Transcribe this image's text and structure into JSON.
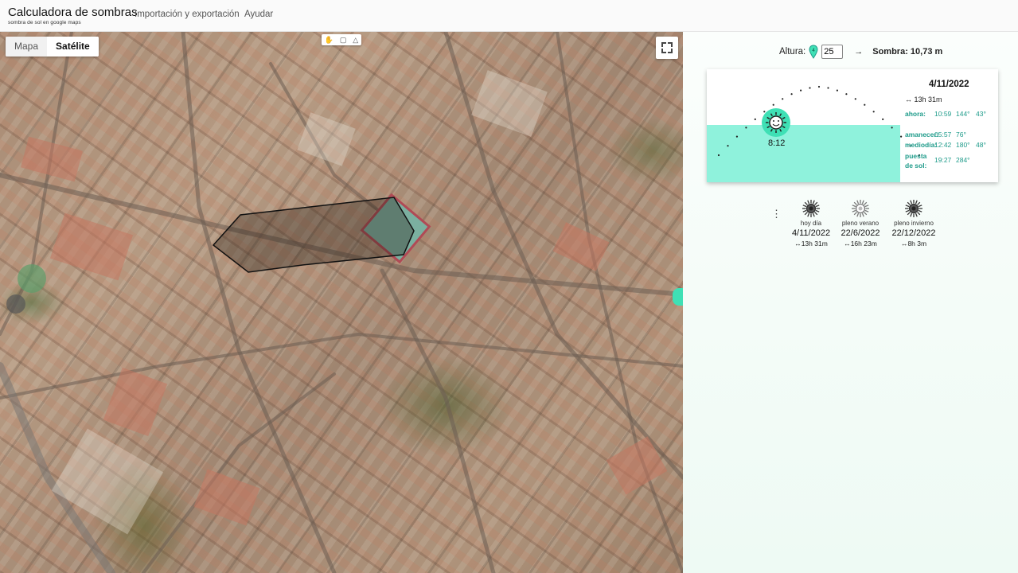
{
  "app": {
    "title": "Calculadora de sombras",
    "subtitle": "sombra de sol en google maps"
  },
  "nav": {
    "import_export": "Importación y exportación",
    "help": "Ayudar"
  },
  "map": {
    "type_map": "Mapa",
    "type_satellite": "Satélite",
    "selected_type": "Satélite",
    "tool_icons": [
      "hand-icon",
      "rectangle-icon",
      "polygon-icon"
    ],
    "fullscreen_icon": "fullscreen-icon"
  },
  "height": {
    "label": "Altura:",
    "pin_number": "4",
    "value": "25",
    "arrow": "→",
    "shadow": "Sombra: 10,73 m"
  },
  "sun": {
    "date": "4/11/2022",
    "day_length": "↔ 13h 31m",
    "current_time": "8:12",
    "rows": [
      {
        "label": "ahora:",
        "time": "10:59",
        "azimuth": "144°",
        "altitude": "43°"
      },
      {
        "label": "amanecer:",
        "time": "05:57",
        "azimuth": "76°",
        "altitude": ""
      },
      {
        "label": "mediodía:",
        "time": "12:42",
        "azimuth": "180°",
        "altitude": "48°"
      },
      {
        "label": "puesta de sol:",
        "time": "19:27",
        "azimuth": "284°",
        "altitude": ""
      }
    ],
    "colors": {
      "daylight": "#8ff2dc",
      "sun": "#3fe0b5",
      "accent": "#1e9b8a"
    }
  },
  "days": [
    {
      "name": "hoy día",
      "date": "4/11/2022",
      "length": "↔13h 31m"
    },
    {
      "name": "pleno verano",
      "date": "22/6/2022",
      "length": "↔16h 23m"
    },
    {
      "name": "pleno invierno",
      "date": "22/12/2022",
      "length": "↔8h 3m"
    }
  ]
}
